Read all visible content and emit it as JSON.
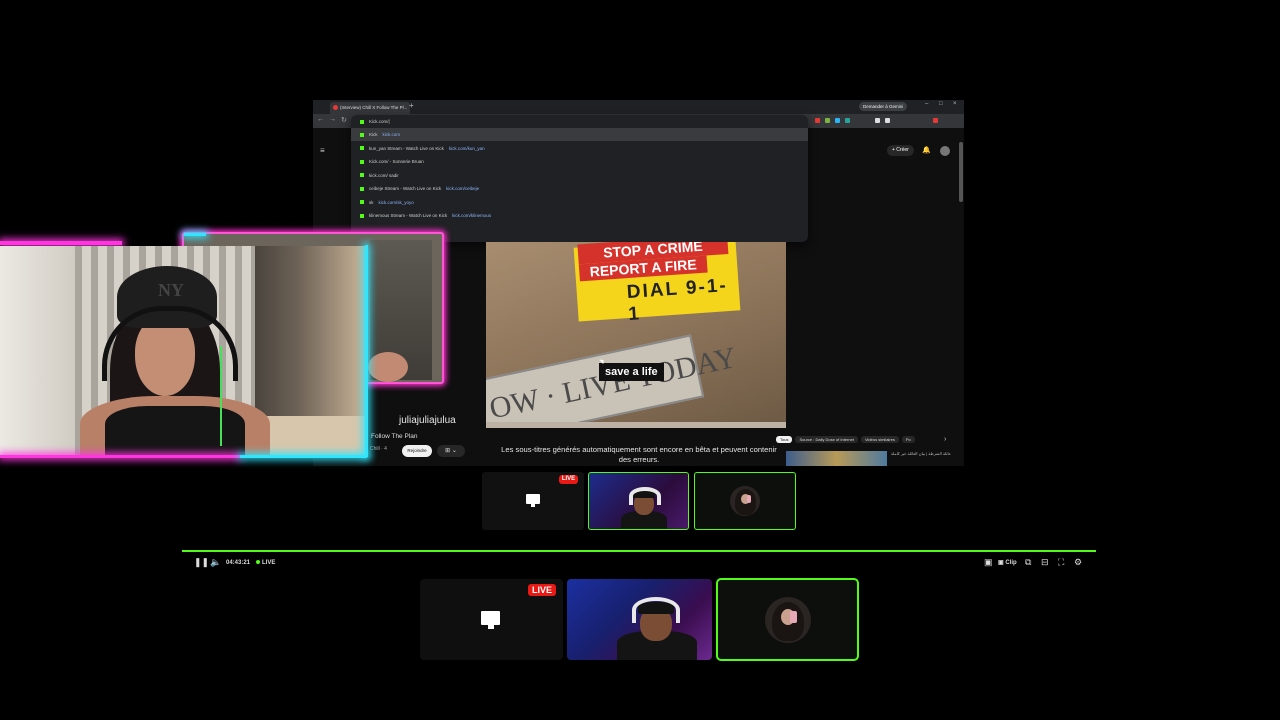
{
  "browser": {
    "tab_title": "(Interview) Chill X Follow The Pl...",
    "new_tab": "+",
    "signin_label": "Demander à Gemini",
    "omnibox": {
      "input_value": "Kick.com/|",
      "suggestions": [
        {
          "text": "Kick",
          "url": "kick.com"
        },
        {
          "text": "kun_yan Stream - Watch Live on Kick",
          "url": "kick.com/kun_yan"
        },
        {
          "text": "Kick.com/ - Sonnerie Bruan",
          "url": ""
        },
        {
          "text": "kick.com/ sadir",
          "url": ""
        },
        {
          "text": "ceibeje Stream - Watch Live on Kick",
          "url": "kick.com/ceibeje"
        },
        {
          "text": "sk",
          "url": "kick.com/sk_yoyo"
        },
        {
          "text": "klinemous Stream - Watch Live on Kick",
          "url": "kick.com/klinemous"
        }
      ]
    },
    "create_label": "+ Créer",
    "video_caption": "save a life",
    "sign_texts": {
      "line1": "STOP A CRIME",
      "line2": "REPORT A FIRE",
      "line3": "DIAL 9-1-1"
    },
    "plate_text": "OW · LIVE TODAY",
    "subtitle_notice": "Les sous-titres générés automatiquement sont encore en bêta et peuvent contenir des erreurs.",
    "playlist_title": "Follow The Plan",
    "playlist_sub": "Chill · 4",
    "subscribe_label": "Rejoindre",
    "chips": [
      {
        "label": "Tous",
        "active": true
      },
      {
        "label": "Source : Daily Dose of Internet",
        "active": false
      },
      {
        "label": "Vidéos similaires",
        "active": false
      },
      {
        "label": "Po",
        "active": false
      }
    ],
    "rec_text": "عائلة الشرطة | بيان العائلة غير كاملة"
  },
  "webcam": {
    "streamer_name": "juliajuliajulua"
  },
  "mini_bar": {
    "live_label": "LIVE"
  },
  "player": {
    "time": "04:43:21",
    "live_label": "LIVE",
    "clip_label": "Clip",
    "accent": "#53fc18"
  },
  "stream_bar": {
    "live_label": "LIVE",
    "live_color": "#e91916"
  }
}
